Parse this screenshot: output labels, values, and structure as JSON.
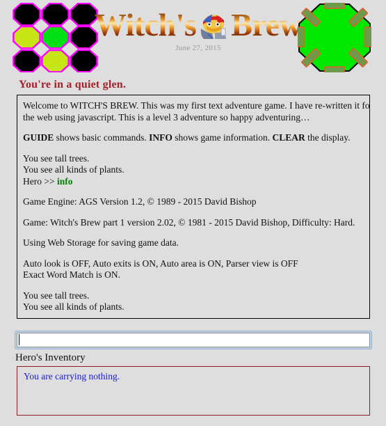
{
  "header": {
    "title": "Witch's Brew",
    "title_part_1": "Witch's",
    "title_part_2": "Brew",
    "date": "June 27, 2015",
    "emblem_icon": "witch-face-icon",
    "grid_icon": "octagon-grid-icon",
    "right_icon": "green-octagon-icon"
  },
  "colors": {
    "page_background": "#dedede",
    "tagline": "#a52029",
    "command_echo": "#008000",
    "inventory_text": "#1a1ad0",
    "inventory_border": "#8f1f1f",
    "panel_border": "#000000",
    "grid_outline": "#ff00ff",
    "grid_black": "#000000",
    "grid_yellow_green": "#c8e615",
    "grid_green": "#00e015",
    "emblem_green": "#00e800",
    "emblem_tab": "#6b9b4b",
    "emblem_tab_border": "#e06030",
    "focus_ring": "#bcd0e2"
  },
  "octagon_grid": [
    "black",
    "black",
    "black",
    "yellow-green",
    "green",
    "black",
    "black",
    "yellow-green",
    "black"
  ],
  "tagline": "You're in a quiet glen.",
  "story": {
    "intro_line_1": "Welcome to WITCH'S BREW. This was my first text adventure game. I have re-written it for",
    "intro_line_2": "the web using javascript. This is a level 3 adventure so happy adventuring…",
    "guide_kw_1": "GUIDE",
    "guide_mid_1": " shows basic commands. ",
    "guide_kw_2": "INFO",
    "guide_mid_2": " shows game information. ",
    "guide_kw_3": "CLEAR",
    "guide_end": " the display.",
    "look_1": "You see tall trees.",
    "look_2": "You see all kinds of plants.",
    "prompt_label": "Hero >> ",
    "prompt_command": "info",
    "engine": "Game Engine: AGS Version 1.2, © 1989 - 2015 David Bishop",
    "game_info": "Game: Witch's Brew part 1 version 2.02, © 1981 - 2015 David Bishop, Difficulty: Hard.",
    "storage": "Using Web Storage for saving game data.",
    "settings_1": "Auto look is OFF, Auto exits is ON, Auto area is ON, Parser view is OFF",
    "settings_2": "Exact Word Match is ON.",
    "look_3": "You see tall trees.",
    "look_4": "You see all kinds of plants."
  },
  "command": {
    "value": "",
    "placeholder": ""
  },
  "inventory": {
    "label": "Hero's Inventory",
    "text": "You are carrying nothing."
  }
}
